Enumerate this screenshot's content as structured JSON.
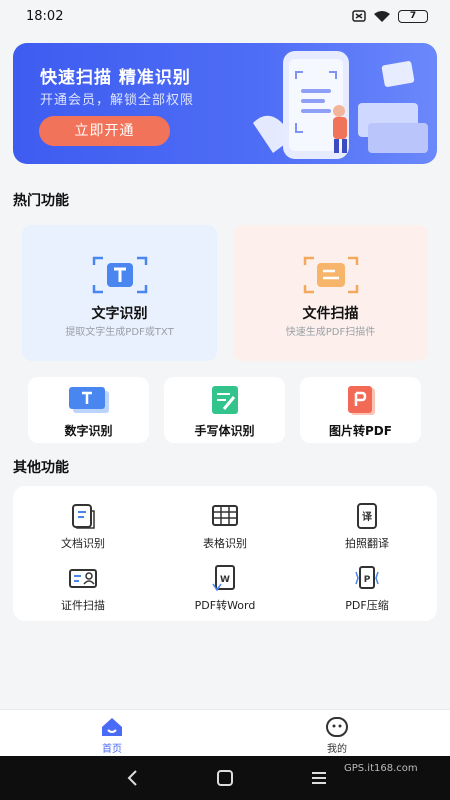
{
  "status_bar": {
    "time": "18:02",
    "battery": "7"
  },
  "banner": {
    "title": "快速扫描  精准识别",
    "subtitle": "开通会员，解锁全部权限",
    "button": "立即开通"
  },
  "hot_section": {
    "title": "热门功能"
  },
  "hot_cards": [
    {
      "name": "文字识别",
      "desc": "提取文字生成PDF或TXT",
      "icon": "text-scan-icon"
    },
    {
      "name": "文件扫描",
      "desc": "快速生成PDF扫描件",
      "icon": "document-scan-icon"
    }
  ],
  "small_cards": [
    {
      "name": "数字识别",
      "icon": "number-scan-icon"
    },
    {
      "name": "手写体识别",
      "icon": "handwriting-icon"
    },
    {
      "name": "图片转PDF",
      "icon": "image-to-pdf-icon"
    }
  ],
  "other_section": {
    "title": "其他功能"
  },
  "other_items": [
    {
      "name": "文档识别",
      "icon": "document-icon"
    },
    {
      "name": "表格识别",
      "icon": "table-icon"
    },
    {
      "name": "拍照翻译",
      "icon": "translate-icon"
    },
    {
      "name": "证件扫描",
      "icon": "id-card-icon"
    },
    {
      "name": "PDF转Word",
      "icon": "pdf-to-word-icon"
    },
    {
      "name": "PDF压缩",
      "icon": "pdf-compress-icon"
    }
  ],
  "tabs": [
    {
      "label": "首页",
      "active": true
    },
    {
      "label": "我的",
      "active": false
    }
  ],
  "watermark": {
    "text": "GPS.it168.com"
  },
  "colors": {
    "accent": "#4a6bf5",
    "banner_button": "#f0735a",
    "hot_card_blue": "#e8f1fd",
    "hot_card_peach": "#fdf0ec"
  }
}
